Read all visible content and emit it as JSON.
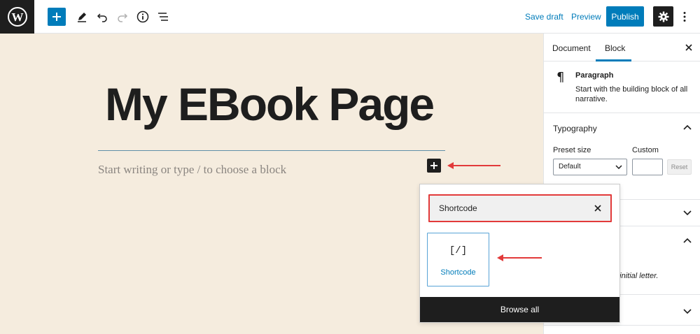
{
  "topbar": {
    "save_draft": "Save draft",
    "preview": "Preview",
    "publish": "Publish",
    "accent": "#007cba"
  },
  "editor": {
    "title": "My EBook Page",
    "placeholder": "Start writing or type / to choose a block",
    "background": "#f5ecde"
  },
  "inserter": {
    "search_value": "Shortcode",
    "block_icon": "[/]",
    "block_label": "Shortcode",
    "browse_all": "Browse all"
  },
  "sidebar": {
    "tabs": [
      {
        "label": "Document"
      },
      {
        "label": "Block"
      }
    ],
    "block_card": {
      "title": "Paragraph",
      "description": "Start with the building block of all narrative."
    },
    "typography": {
      "title": "Typography",
      "preset_label": "Preset size",
      "custom_label": "Custom",
      "preset_value": "Default",
      "reset": "Reset"
    },
    "partial_text": "e initial letter."
  },
  "icons": {
    "logo": "wordpress-logo",
    "add": "plus-icon",
    "edit": "pencil-icon",
    "undo": "undo-icon",
    "redo": "redo-icon",
    "info": "info-icon",
    "outline": "list-view-icon",
    "settings": "gear-icon",
    "more": "more-vertical-icon",
    "close": "close-icon",
    "paragraph": "paragraph-icon",
    "chevron": "chevron-icon"
  },
  "annotation_color": "#e23a3a"
}
